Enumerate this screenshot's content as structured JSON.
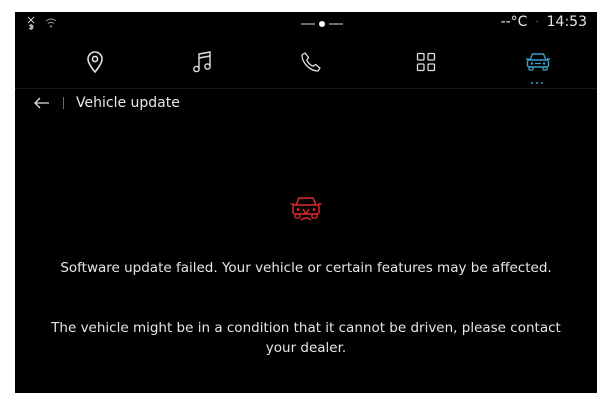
{
  "status": {
    "temperature": "--°C",
    "separator": "·",
    "time": "14:53"
  },
  "nav": {
    "items": [
      {
        "icon": "location-pin-icon"
      },
      {
        "icon": "music-note-icon"
      },
      {
        "icon": "phone-icon"
      },
      {
        "icon": "apps-grid-icon"
      },
      {
        "icon": "car-icon",
        "active": true
      }
    ],
    "active_color": "#3aa0c8"
  },
  "header": {
    "title": "Vehicle update"
  },
  "message": {
    "icon": "car-warning-icon",
    "icon_color": "#e02a2a",
    "primary": "Software update failed. Your vehicle or certain features may be affected.",
    "secondary": "The vehicle might be in a condition that it cannot be driven, please contact your dealer."
  }
}
